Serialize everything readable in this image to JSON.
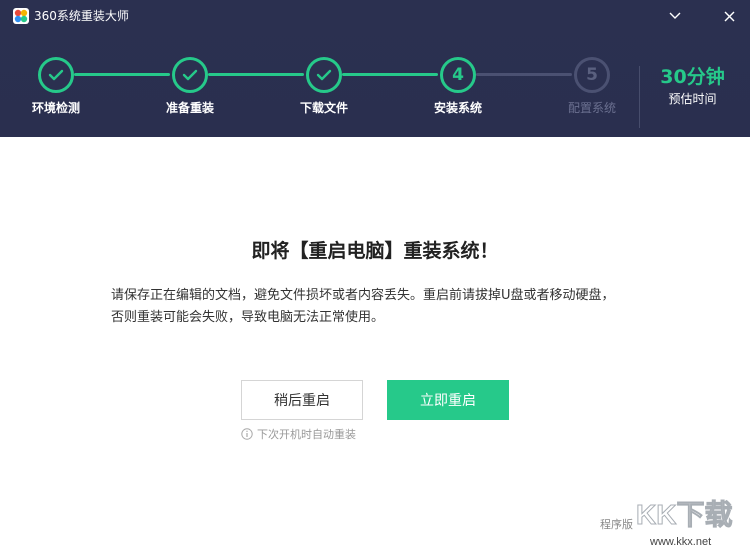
{
  "window": {
    "title": "360系统重装大师",
    "logo": "app-logo-icon",
    "minimize_icon": "chevron-down-icon",
    "close_icon": "close-icon"
  },
  "steps": [
    {
      "label": "环境检测",
      "status": "done"
    },
    {
      "label": "准备重装",
      "status": "done"
    },
    {
      "label": "下载文件",
      "status": "done"
    },
    {
      "label": "安装系统",
      "status": "active",
      "number": "4"
    },
    {
      "label": "配置系统",
      "status": "pending",
      "number": "5"
    }
  ],
  "eta": {
    "value": "30分钟",
    "label": "预估时间"
  },
  "main": {
    "title": "即将【重启电脑】重装系统！",
    "desc_line1": "请保存正在编辑的文档，避免文件损坏或者内容丢失。重启前请拔掉U盘或者移动硬盘，",
    "desc_line2": "否则重装可能会失败，导致电脑无法正常使用。",
    "btn_later": "稍后重启",
    "btn_now": "立即重启",
    "hint": "下次开机时自动重装",
    "hint_icon": "info-icon"
  },
  "footer": {
    "text": "程序版"
  },
  "watermark": {
    "brand": "KK下载",
    "url": "www.kkx.net"
  },
  "colors": {
    "header_bg": "#2b3050",
    "accent": "#26c98a",
    "inactive": "#4b5172"
  }
}
